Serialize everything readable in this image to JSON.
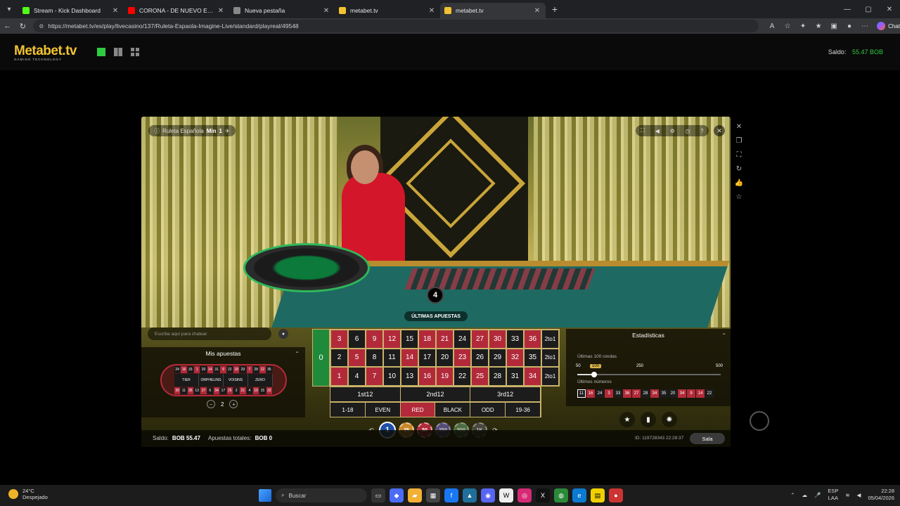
{
  "browser": {
    "tabs": [
      {
        "title": "Stream - Kick Dashboard",
        "color": "#53fc18",
        "active": false
      },
      {
        "title": "CORONA - DE NUEVO EN EL",
        "color": "#ff0000",
        "active": false
      },
      {
        "title": "Nueva pestaña",
        "color": "#888888",
        "active": false
      },
      {
        "title": "metabet.tv",
        "color": "#f2c230",
        "active": false
      },
      {
        "title": "metabet.tv",
        "color": "#f2c230",
        "active": true
      }
    ],
    "url": "https://metabet.tv/es/play/livecasino/137/Ruleta-Espaola-Imagine-Live/standard/playreal/49548",
    "chat_label": "Chat"
  },
  "site": {
    "logo": "Metabet.tv",
    "logo_sub": "GAMING TECHNOLOGY",
    "balance_label": "Saldo:",
    "balance_value": "55.47 BOB"
  },
  "game": {
    "name": "Ruleta Española",
    "min_label": "Min",
    "min_value": "1",
    "result": "4",
    "last_bets_label": "ÚLTIMAS APUESTAS",
    "chat_placeholder": "Escriba aquí para chatear",
    "my_bets": {
      "title": "Mis apuestas",
      "top_numbers": [
        "24",
        "16",
        "33",
        "1",
        "20",
        "14",
        "31",
        "9",
        "22",
        "18",
        "29",
        "7",
        "28",
        "12",
        "35"
      ],
      "bottom_numbers": [
        "30",
        "11",
        "36",
        "13",
        "27",
        "6",
        "34",
        "17",
        "25",
        "2",
        "21",
        "4",
        "19",
        "15",
        "32"
      ],
      "sections": [
        "TIER",
        "ORPHELINS",
        "VOISINS",
        "ZERO"
      ],
      "stepper_value": "2"
    },
    "grid": {
      "zero": "0",
      "rows": [
        [
          {
            "n": "3",
            "c": "red"
          },
          {
            "n": "6",
            "c": "black"
          },
          {
            "n": "9",
            "c": "red"
          },
          {
            "n": "12",
            "c": "red"
          },
          {
            "n": "15",
            "c": "black"
          },
          {
            "n": "18",
            "c": "red"
          },
          {
            "n": "21",
            "c": "red"
          },
          {
            "n": "24",
            "c": "black"
          },
          {
            "n": "27",
            "c": "red"
          },
          {
            "n": "30",
            "c": "red"
          },
          {
            "n": "33",
            "c": "black"
          },
          {
            "n": "36",
            "c": "red"
          },
          {
            "n": "2to1",
            "c": "col"
          }
        ],
        [
          {
            "n": "2",
            "c": "black"
          },
          {
            "n": "5",
            "c": "red"
          },
          {
            "n": "8",
            "c": "black"
          },
          {
            "n": "11",
            "c": "black"
          },
          {
            "n": "14",
            "c": "red"
          },
          {
            "n": "17",
            "c": "black"
          },
          {
            "n": "20",
            "c": "black"
          },
          {
            "n": "23",
            "c": "red"
          },
          {
            "n": "26",
            "c": "black"
          },
          {
            "n": "29",
            "c": "black"
          },
          {
            "n": "32",
            "c": "red"
          },
          {
            "n": "35",
            "c": "black"
          },
          {
            "n": "2to1",
            "c": "col"
          }
        ],
        [
          {
            "n": "1",
            "c": "red"
          },
          {
            "n": "4",
            "c": "black"
          },
          {
            "n": "7",
            "c": "red"
          },
          {
            "n": "10",
            "c": "black"
          },
          {
            "n": "13",
            "c": "black"
          },
          {
            "n": "16",
            "c": "red"
          },
          {
            "n": "19",
            "c": "red"
          },
          {
            "n": "22",
            "c": "black"
          },
          {
            "n": "25",
            "c": "red"
          },
          {
            "n": "28",
            "c": "black"
          },
          {
            "n": "31",
            "c": "black"
          },
          {
            "n": "34",
            "c": "red"
          },
          {
            "n": "2to1",
            "c": "col"
          }
        ]
      ],
      "dozens": [
        "1st12",
        "2nd12",
        "3rd12"
      ],
      "outside": [
        {
          "label": "1-18",
          "c": ""
        },
        {
          "label": "EVEN",
          "c": ""
        },
        {
          "label": "RED",
          "c": "red"
        },
        {
          "label": "BLACK",
          "c": ""
        },
        {
          "label": "ODD",
          "c": ""
        },
        {
          "label": "19-36",
          "c": ""
        }
      ]
    },
    "stats": {
      "title": "Estadísticas",
      "rounds_label": "Últimas 100 rondas",
      "slider_marks": [
        "50",
        "100",
        "250",
        "500"
      ],
      "slider_level": 0.12,
      "last_numbers_label": "Últimos números",
      "last_numbers": [
        {
          "n": "11",
          "c": "black"
        },
        {
          "n": "16",
          "c": "red"
        },
        {
          "n": "24",
          "c": "black"
        },
        {
          "n": "3",
          "c": "red"
        },
        {
          "n": "33",
          "c": "black"
        },
        {
          "n": "36",
          "c": "red"
        },
        {
          "n": "27",
          "c": "red"
        },
        {
          "n": "28",
          "c": "black"
        },
        {
          "n": "34",
          "c": "red"
        },
        {
          "n": "35",
          "c": "black"
        },
        {
          "n": "20",
          "c": "black"
        },
        {
          "n": "34",
          "c": "red"
        },
        {
          "n": "9",
          "c": "red"
        },
        {
          "n": "14",
          "c": "red"
        },
        {
          "n": "22",
          "c": "black"
        }
      ]
    },
    "chips": [
      "1",
      "25",
      "50",
      "250",
      "500",
      "1K"
    ],
    "footer": {
      "balance_label": "Saldo:",
      "balance_value": "BOB 55.47",
      "total_label": "Apuestas totales:",
      "total_value": "BOB 0",
      "id": "ID: 119728343  22:28:37",
      "room_button": "Sala"
    }
  },
  "taskbar": {
    "temp": "24°C",
    "weather": "Despejado",
    "search": "Buscar",
    "lang_top": "ESP",
    "lang_bottom": "LAA",
    "time": "22:28",
    "date": "05/04/2026"
  }
}
